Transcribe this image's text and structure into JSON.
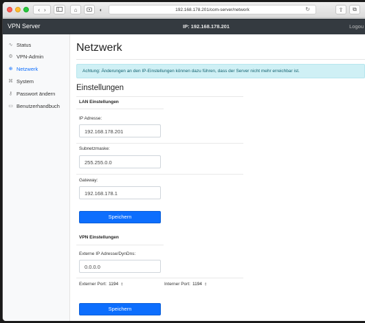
{
  "browser": {
    "url": "192.168.178.201/com-server/network",
    "icons": [
      "back-icon",
      "forward-icon",
      "sidebar-icon",
      "home-icon",
      "extension-icon",
      "shield-icon",
      "reload-icon",
      "share-icon",
      "tabs-icon"
    ]
  },
  "navbar": {
    "brand": "VPN Server",
    "ip_label": "IP: 192.168.178.201",
    "logout": "Logou"
  },
  "sidebar": {
    "items": [
      {
        "label": "Status",
        "icon": "activity-icon",
        "active": false
      },
      {
        "label": "VPN-Admin",
        "icon": "gear-icon",
        "active": false
      },
      {
        "label": "Netzwerk",
        "icon": "globe-icon",
        "active": true
      },
      {
        "label": "System",
        "icon": "cog-icon",
        "active": false
      },
      {
        "label": "Passwort ändern",
        "icon": "key-icon",
        "active": false
      },
      {
        "label": "Benutzerhandbuch",
        "icon": "book-icon",
        "active": false
      }
    ]
  },
  "main": {
    "title": "Netzwerk",
    "alert": "Achtung: Änderungen an den IP-Einstellungen können dazu führen, dass der Server nicht mehr erreichbar ist.",
    "section_title": "Einstellungen",
    "lan": {
      "title": "LAN Einstellungen",
      "ip_label": "IP Adresse:",
      "ip_value": "192.168.178.201",
      "subnet_label": "Subnetzmaske:",
      "subnet_value": "255.255.0.0",
      "gateway_label": "Gateway:",
      "gateway_value": "192.168.178.1",
      "save_label": "Speichern"
    },
    "vpn": {
      "title": "VPN Einstellungen",
      "external_ip_label": "Externe IP Adresse/DynDns:",
      "external_ip_value": "0.0.0.0",
      "external_port_label": "Externer Port:",
      "external_port_value": "1194",
      "internal_port_label": "Interner Port:",
      "internal_port_value": "1194",
      "save_label": "Speichern"
    }
  },
  "colors": {
    "navbar": "#343a40",
    "primary": "#0d6efd",
    "alert_bg": "#cff0f5",
    "alert_text": "#11606e"
  }
}
